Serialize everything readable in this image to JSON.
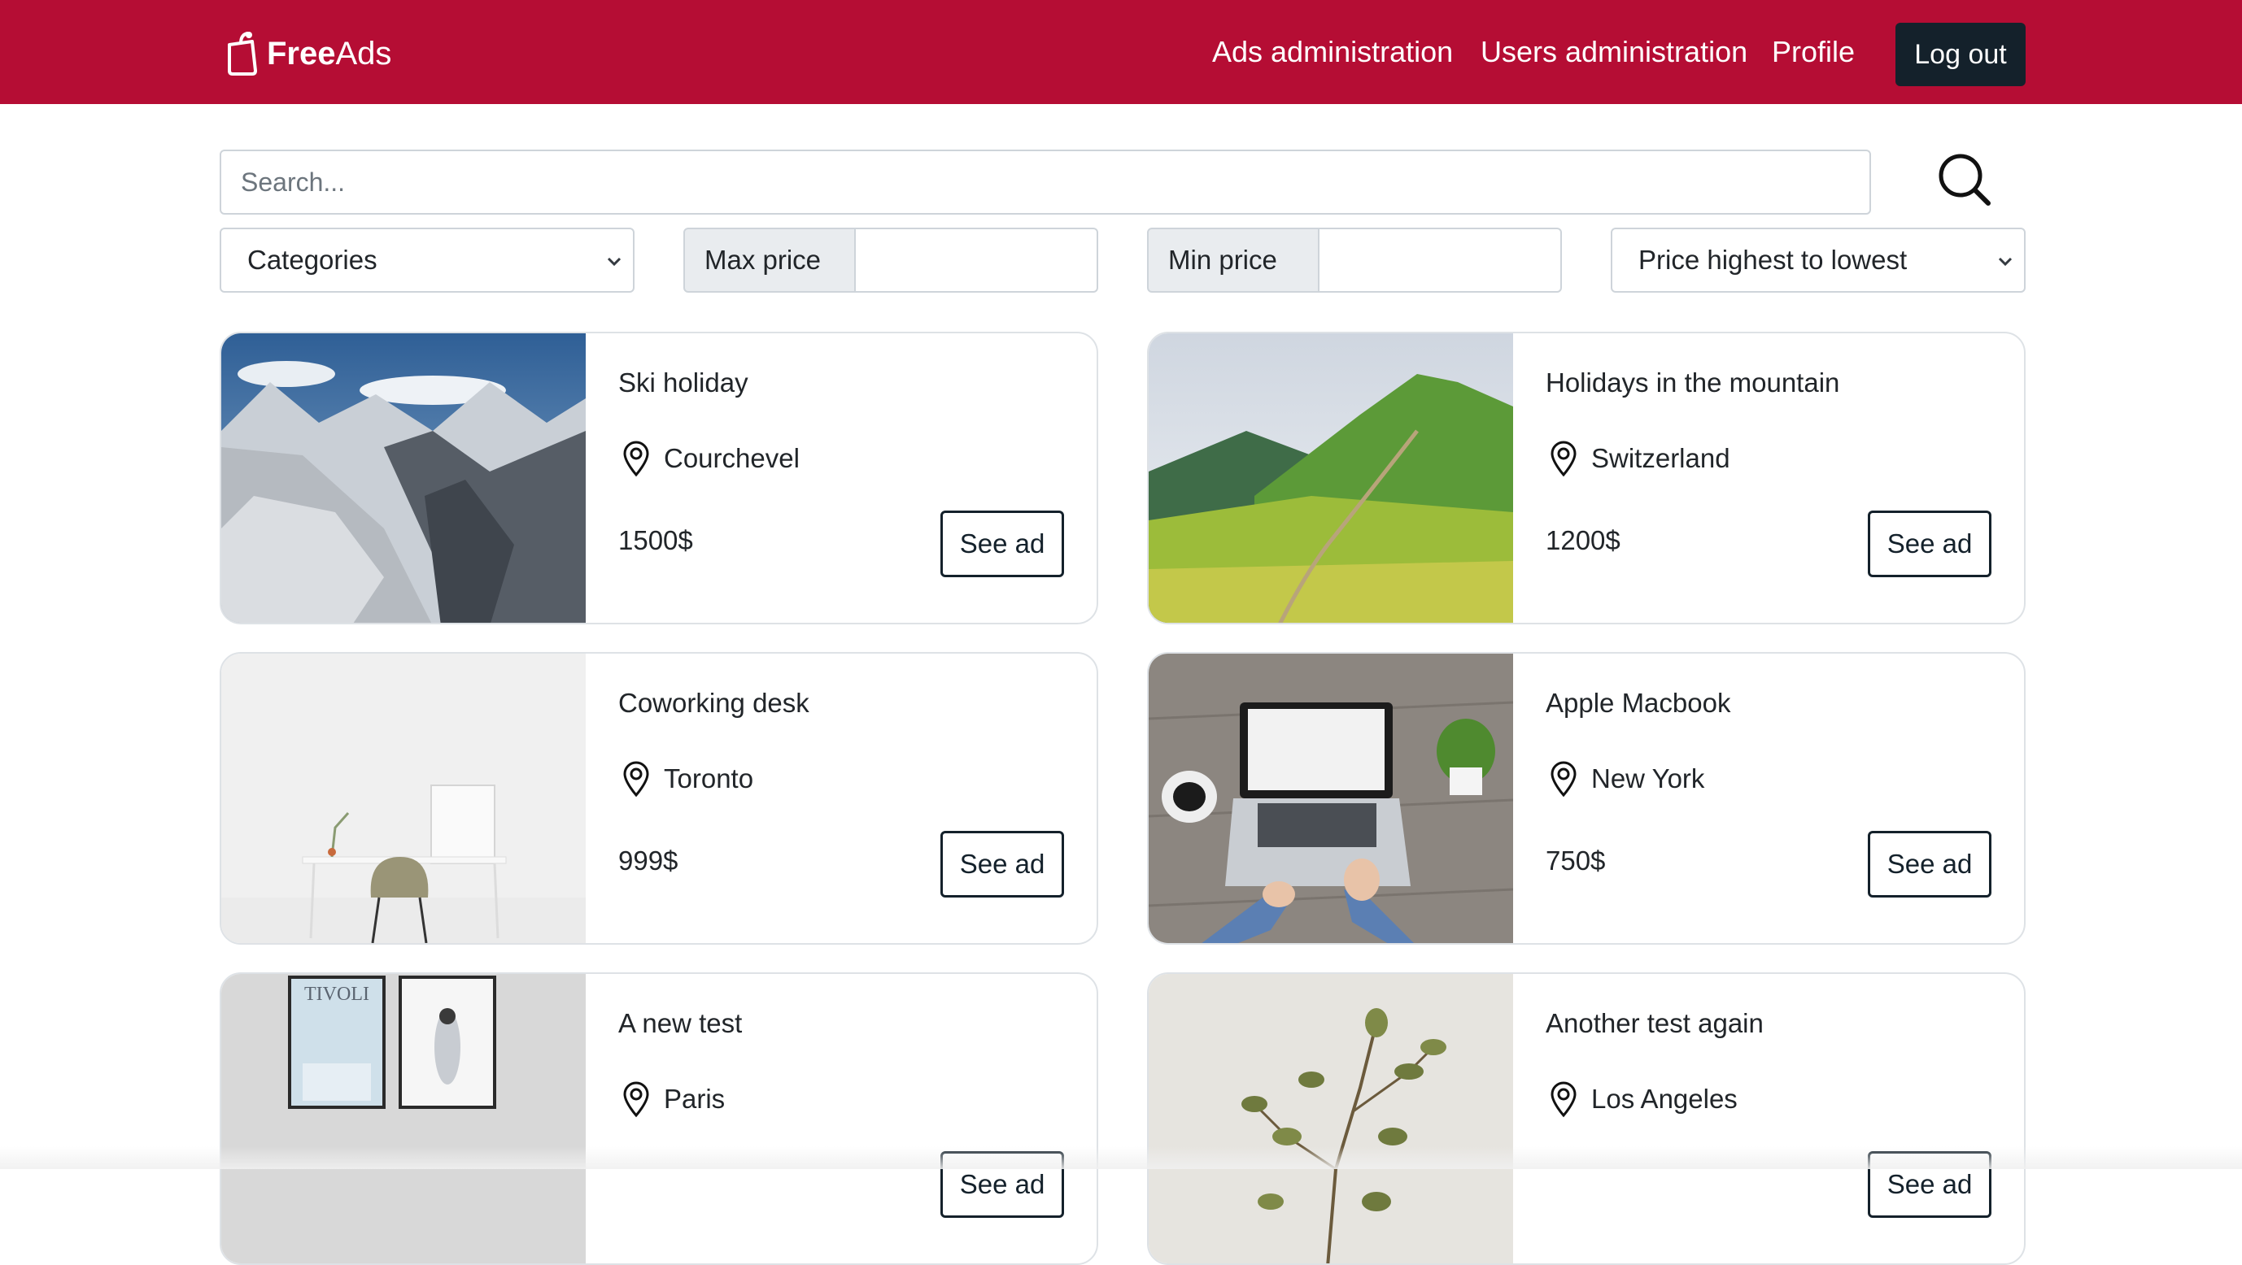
{
  "navbar": {
    "brand": {
      "free": "Free",
      "ads": "Ads",
      "logo_icon": "bag-tag-icon"
    },
    "links": [
      "Ads administration",
      "Users administration",
      "Profile"
    ],
    "logout_label": "Log out"
  },
  "search": {
    "placeholder": "Search...",
    "value": "",
    "icon": "search-icon"
  },
  "filters": {
    "category": "Categories",
    "max_price": {
      "label": "Max price",
      "value": ""
    },
    "min_price": {
      "label": "Min price",
      "value": ""
    },
    "sort": "Price highest to lowest"
  },
  "ads": [
    {
      "title": "Ski holiday",
      "location": "Courchevel",
      "price": "1500$",
      "button": "See ad",
      "image": "snowy-mountains-photo"
    },
    {
      "title": "Holidays in the mountain",
      "location": "Switzerland",
      "price": "1200$",
      "button": "See ad",
      "image": "green-hills-photo"
    },
    {
      "title": "Coworking desk",
      "location": "Toronto",
      "price": "999$",
      "button": "See ad",
      "image": "white-desk-photo"
    },
    {
      "title": "Apple Macbook",
      "location": "New York",
      "price": "750$",
      "button": "See ad",
      "image": "laptop-on-table-photo"
    },
    {
      "title": "A new test",
      "location": "Paris",
      "price": "",
      "button": "See ad",
      "image": "framed-posters-photo",
      "poster_text": "TIVOLI"
    },
    {
      "title": "Another test again",
      "location": "Los Angeles",
      "price": "",
      "button": "See ad",
      "image": "plant-in-vase-photo"
    }
  ]
}
